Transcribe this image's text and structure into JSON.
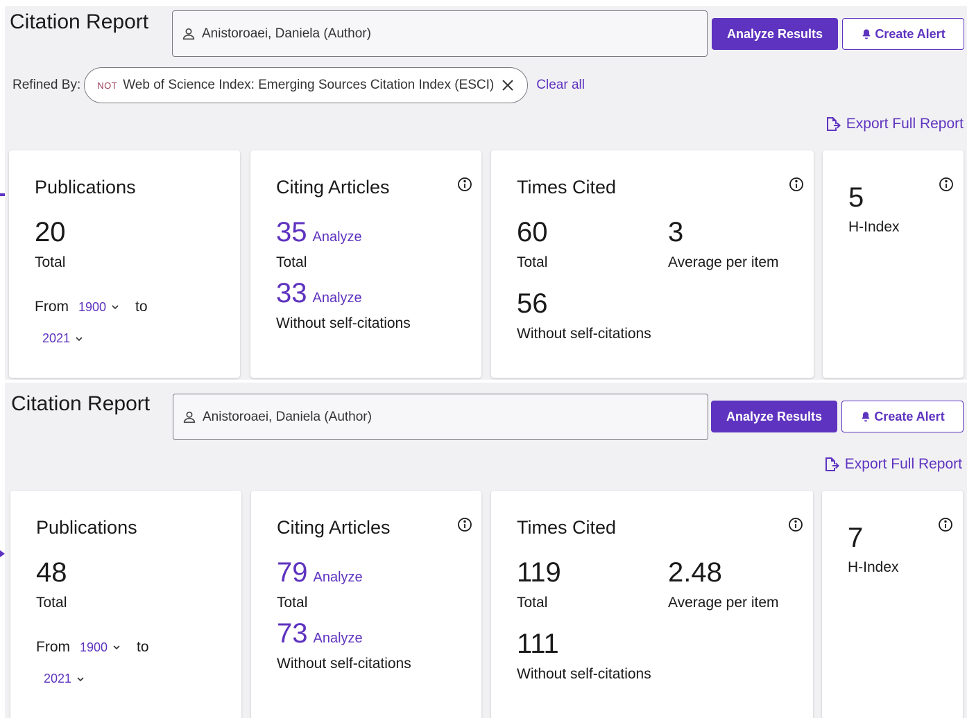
{
  "reports": [
    {
      "title": "Citation Report",
      "query": "Anistoroaei, Daniela (Author)",
      "analyze_results_label": "Analyze Results",
      "create_alert_label": "Create Alert",
      "refined_by_label": "Refined By:",
      "refine_chip": {
        "not_tag": "NOT",
        "text": "Web of Science Index: Emerging Sources Citation Index (ESCI)"
      },
      "clear_all_label": "Clear all",
      "export_label": "Export Full Report",
      "publications": {
        "title": "Publications",
        "total": "20",
        "total_label": "Total",
        "from_label": "From",
        "from_year": "1900",
        "to_label": "to",
        "to_year": "2021"
      },
      "citing_articles": {
        "title": "Citing Articles",
        "total": "35",
        "total_label": "Total",
        "without_self": "33",
        "without_self_label": "Without self-citations",
        "analyze_label": "Analyze"
      },
      "times_cited": {
        "title": "Times Cited",
        "total": "60",
        "total_label": "Total",
        "average": "3",
        "average_label": "Average per item",
        "without_self": "56",
        "without_self_label": "Without self-citations"
      },
      "h_index": {
        "value": "5",
        "label": "H-Index"
      }
    },
    {
      "title": "Citation Report",
      "query": "Anistoroaei, Daniela (Author)",
      "analyze_results_label": "Analyze Results",
      "create_alert_label": "Create Alert",
      "export_label": "Export Full Report",
      "publications": {
        "title": "Publications",
        "total": "48",
        "total_label": "Total",
        "from_label": "From",
        "from_year": "1900",
        "to_label": "to",
        "to_year": "2021"
      },
      "citing_articles": {
        "title": "Citing Articles",
        "total": "79",
        "total_label": "Total",
        "without_self": "73",
        "without_self_label": "Without self-citations",
        "analyze_label": "Analyze"
      },
      "times_cited": {
        "title": "Times Cited",
        "total": "119",
        "total_label": "Total",
        "average": "2.48",
        "average_label": "Average per item",
        "without_self": "111",
        "without_self_label": "Without self-citations"
      },
      "h_index": {
        "value": "7",
        "label": "H-Index"
      }
    }
  ],
  "colors": {
    "accent": "#5e33bf",
    "panel_bg": "#f1f1f4",
    "not_tag": "#9b3b57"
  },
  "icons": [
    "person-icon",
    "bell-icon",
    "close-icon",
    "export-icon",
    "info-icon",
    "chevron-down-icon"
  ]
}
